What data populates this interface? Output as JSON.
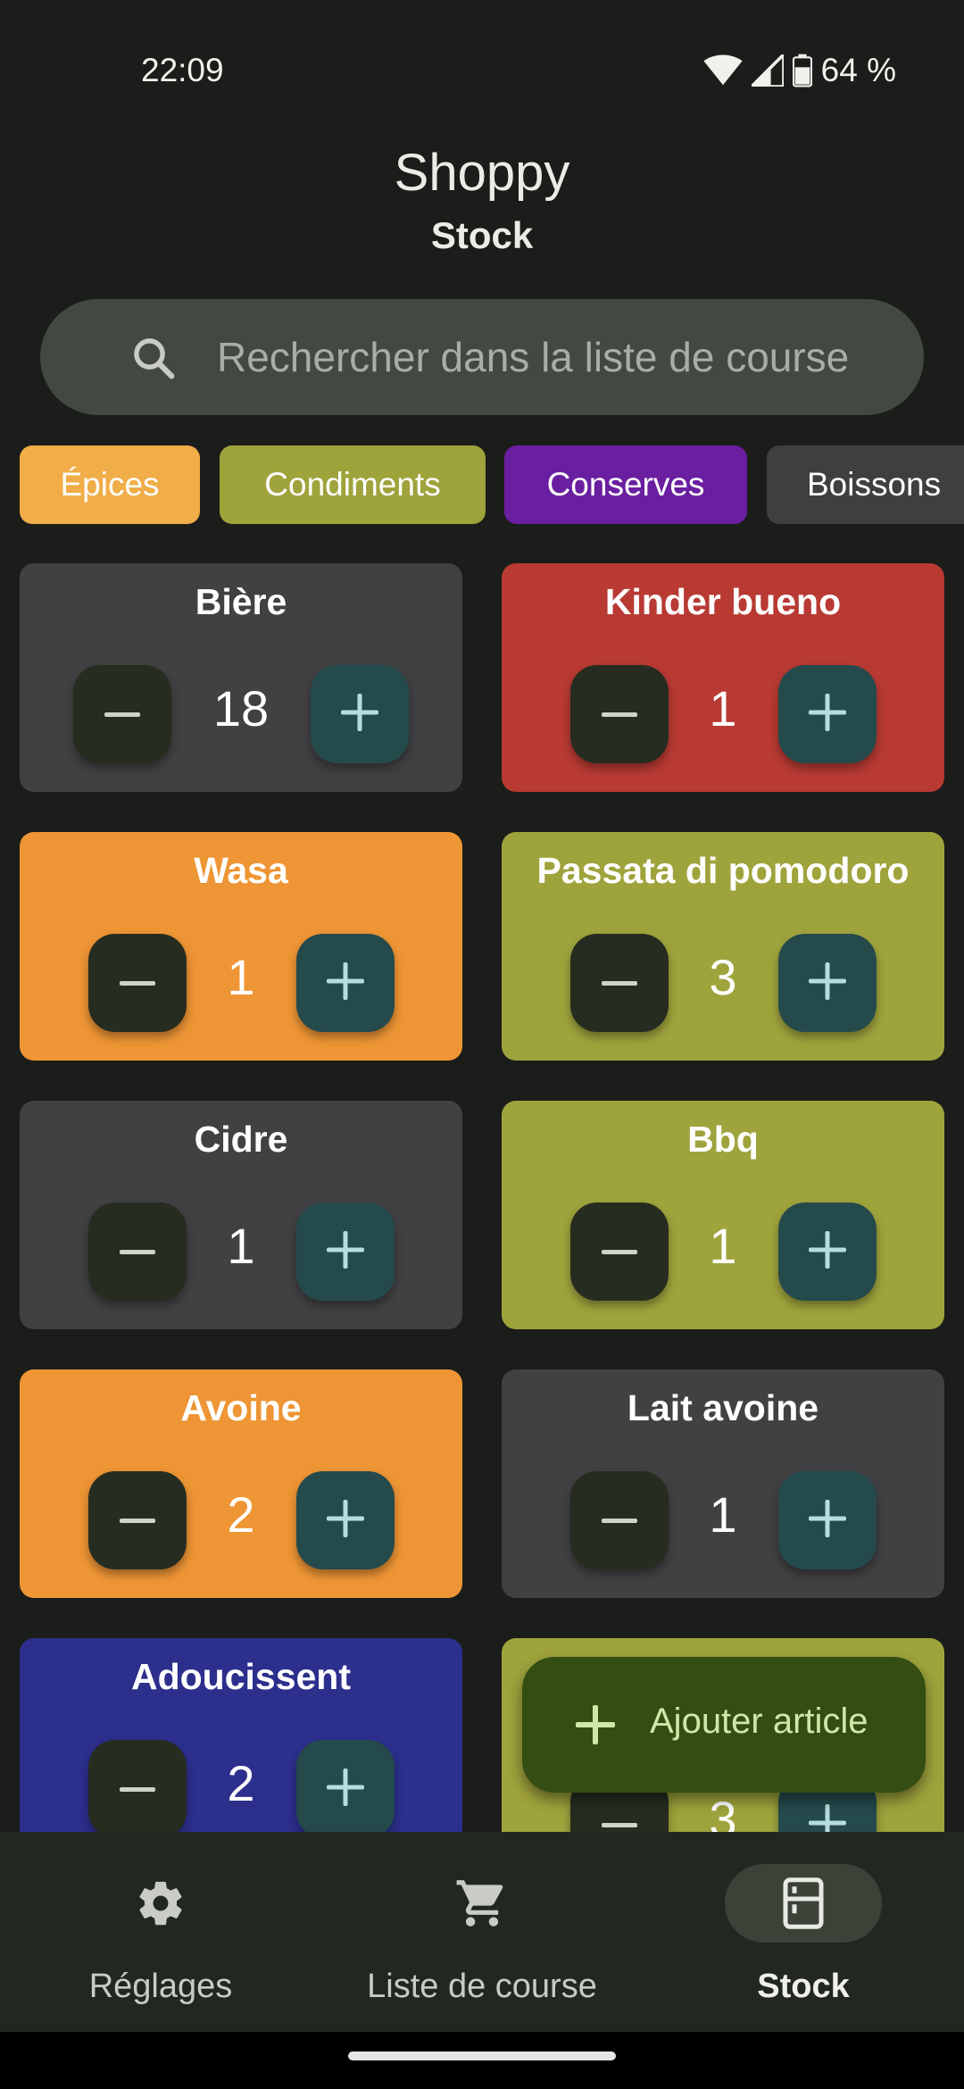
{
  "status_bar": {
    "time": "22:09",
    "battery": "64 %",
    "icons": [
      "wifi-icon",
      "cell-signal-icon",
      "battery-icon"
    ]
  },
  "header": {
    "app_title": "Shoppy",
    "subtitle": "Stock"
  },
  "search": {
    "placeholder": "Rechercher dans la liste de course",
    "value": ""
  },
  "categories": [
    {
      "label": "Épices",
      "color": "#f0ad48"
    },
    {
      "label": "Condiments",
      "color": "#9fa33c"
    },
    {
      "label": "Conserves",
      "color": "#6a1ea0"
    },
    {
      "label": "Boissons",
      "color": "#3f3f41"
    }
  ],
  "items": [
    {
      "name": "Bière",
      "quantity": "18",
      "color": "#414143"
    },
    {
      "name": "Kinder bueno",
      "quantity": "1",
      "color": "#b83a33"
    },
    {
      "name": "Wasa",
      "quantity": "1",
      "color": "#ee9535"
    },
    {
      "name": "Passata di pomodoro",
      "quantity": "3",
      "color": "#9fa33c"
    },
    {
      "name": "Cidre",
      "quantity": "1",
      "color": "#414143"
    },
    {
      "name": "Bbq",
      "quantity": "1",
      "color": "#9fa33c"
    },
    {
      "name": "Avoine",
      "quantity": "2",
      "color": "#ee9535"
    },
    {
      "name": "Lait avoine",
      "quantity": "1",
      "color": "#414143"
    },
    {
      "name": "Adoucissent",
      "quantity": "2",
      "color": "#2c2f8c"
    },
    {
      "name": "",
      "quantity": "3",
      "color": "#9fa33c"
    }
  ],
  "fab": {
    "label": "Ajouter article",
    "icon": "plus-icon"
  },
  "bottom_nav": {
    "items": [
      {
        "label": "Réglages",
        "icon": "gear-icon",
        "active": false
      },
      {
        "label": "Liste de course",
        "icon": "cart-icon",
        "active": false
      },
      {
        "label": "Stock",
        "icon": "fridge-icon",
        "active": true
      }
    ]
  }
}
